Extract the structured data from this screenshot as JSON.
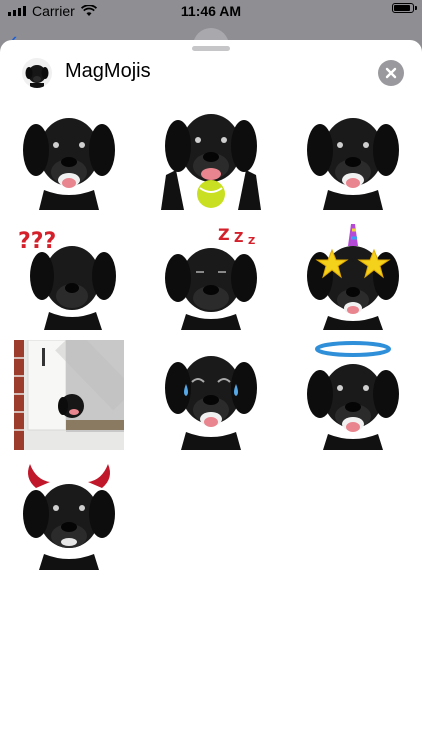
{
  "status": {
    "carrier": "Carrier",
    "time": "11:46 AM"
  },
  "app": {
    "title": "MagMojis",
    "close_icon": "close-icon"
  },
  "stickers": [
    {
      "name": "dog-happy"
    },
    {
      "name": "dog-tennis-ball"
    },
    {
      "name": "dog-happy-2"
    },
    {
      "name": "dog-confused"
    },
    {
      "name": "dog-sleepy"
    },
    {
      "name": "dog-star-eyes"
    },
    {
      "name": "dog-peeking-door"
    },
    {
      "name": "dog-crying-laughing"
    },
    {
      "name": "dog-halo"
    },
    {
      "name": "dog-devil"
    }
  ],
  "colors": {
    "accent": "#1d5fd6",
    "sheet_bg": "#ffffff",
    "dim_bg": "#8f8f93"
  }
}
